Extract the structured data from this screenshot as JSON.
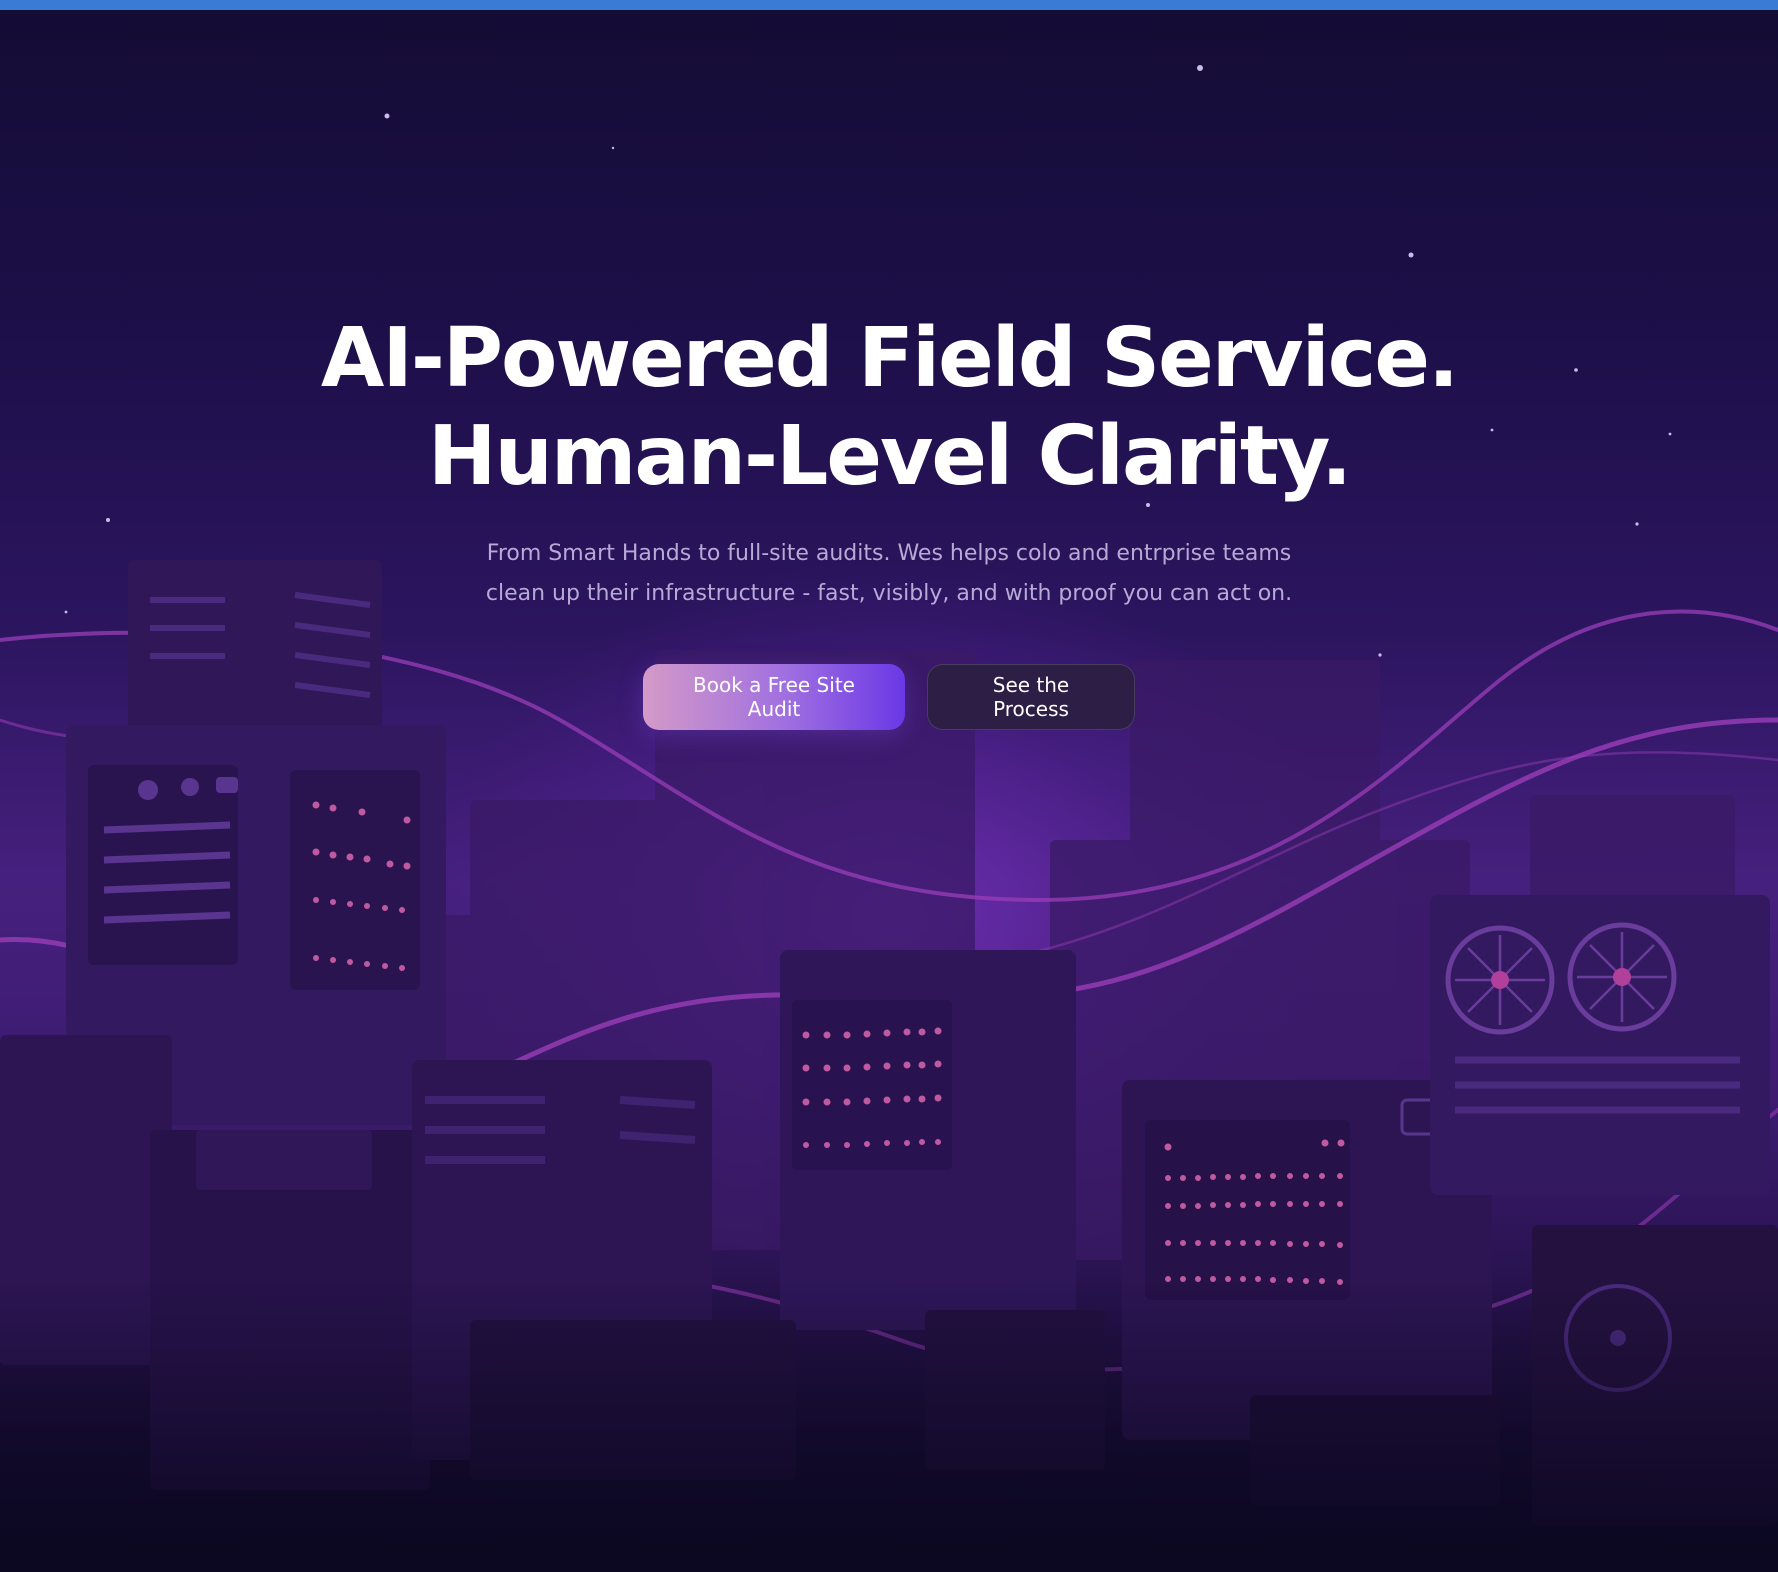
{
  "hero": {
    "headline_line1": "AI-Powered Field Service.",
    "headline_line2": "Human-Level Clarity.",
    "subtitle": "From Smart Hands to full-site audits. Wes helps colo and entrprise teams clean up their infrastructure - fast, visibly, and with proof you can act on.",
    "primary_cta": "Book a Free Site Audit",
    "secondary_cta": "See the Process"
  },
  "colors": {
    "top_bar": "#3a7bd5",
    "background_top": "#140c34",
    "background_glow": "#46207e",
    "cta_gradient_start": "#d49ac8",
    "cta_gradient_end": "#6b38e6",
    "secondary_button": "#2c1e44"
  }
}
